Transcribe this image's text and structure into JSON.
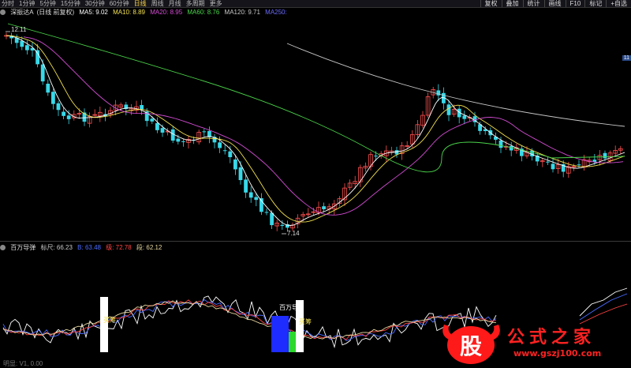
{
  "toolbar": {
    "tabs": [
      {
        "label": "分时"
      },
      {
        "label": "1分钟"
      },
      {
        "label": "5分钟"
      },
      {
        "label": "15分钟"
      },
      {
        "label": "30分钟"
      },
      {
        "label": "60分钟"
      },
      {
        "label": "日线"
      },
      {
        "label": "周线"
      },
      {
        "label": "月线"
      },
      {
        "label": "多周期"
      },
      {
        "label": "更多"
      }
    ],
    "active_index": 6,
    "right_buttons": [
      {
        "label": "复权"
      },
      {
        "label": "叠加"
      },
      {
        "label": "统计"
      },
      {
        "label": "画线"
      },
      {
        "label": "F10"
      },
      {
        "label": "标记"
      },
      {
        "label": "+自选"
      }
    ]
  },
  "main_chart": {
    "name": "深振达A",
    "mode": "(日线 前复权)",
    "ma": [
      {
        "label": "MA5: 9.02",
        "color": "#ffffff"
      },
      {
        "label": "MA10: 8.89",
        "color": "#f2e14f"
      },
      {
        "label": "MA20: 8.95",
        "color": "#d44cd4"
      },
      {
        "label": "MA60: 8.76",
        "color": "#4ad44a"
      },
      {
        "label": "MA120: 9.71",
        "color": "#c8c8c8"
      },
      {
        "label": "MA250:",
        "color": "#6a6aff"
      }
    ],
    "high_label": "12.11",
    "low_label": "7.14",
    "right_tag": "11"
  },
  "indicator": {
    "name": "百万导弹",
    "values": [
      {
        "label": "标尺: 66.23",
        "color": "#c8c8c8"
      },
      {
        "label": "B: 63.48",
        "color": "#4a6aff"
      },
      {
        "label": "级: 72.78",
        "color": "#ff4444"
      },
      {
        "label": "段: 62.12",
        "color": "#e8d8a0"
      }
    ],
    "signal_labels": [
      "买筹",
      "买筹"
    ],
    "bar_label": "百万导"
  },
  "watermark": {
    "logo_char": "股",
    "title": "公式之家",
    "url": "www.gszj100.com"
  },
  "footer": {
    "label": "明显: V1, 0.00"
  },
  "colors": {
    "up": "#ff5050",
    "down": "#38d8e8",
    "bg": "#000000"
  }
}
